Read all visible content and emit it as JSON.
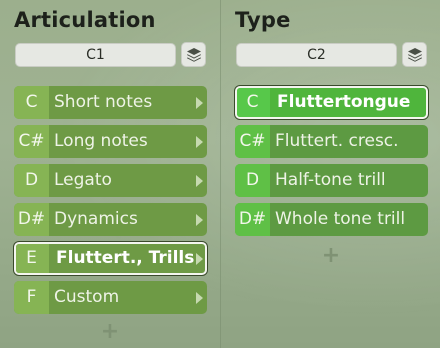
{
  "articulation": {
    "title": "Articulation",
    "preset_value": "C1",
    "add_label": "+",
    "items": [
      {
        "key": "C",
        "label": "Short notes"
      },
      {
        "key": "C#",
        "label": "Long notes"
      },
      {
        "key": "D",
        "label": "Legato"
      },
      {
        "key": "D#",
        "label": "Dynamics"
      },
      {
        "key": "E",
        "label": "Fluttert., Trills"
      },
      {
        "key": "F",
        "label": "Custom"
      }
    ]
  },
  "type": {
    "title": "Type",
    "preset_value": "C2",
    "add_label": "+",
    "items": [
      {
        "key": "C",
        "label": "Fluttertongue"
      },
      {
        "key": "C#",
        "label": "Fluttert. cresc."
      },
      {
        "key": "D",
        "label": "Half-tone trill"
      },
      {
        "key": "D#",
        "label": "Whole tone trill"
      }
    ]
  },
  "icons": {
    "layers": "layers-icon",
    "submenu": "chevron-right-icon",
    "add": "plus-icon"
  },
  "colors": {
    "articulation_row": "#6e9a45",
    "articulation_key": "#86b454",
    "type_row": "#5d9a42",
    "type_key": "#5fc046",
    "selected_border": "#f4f6ef"
  }
}
